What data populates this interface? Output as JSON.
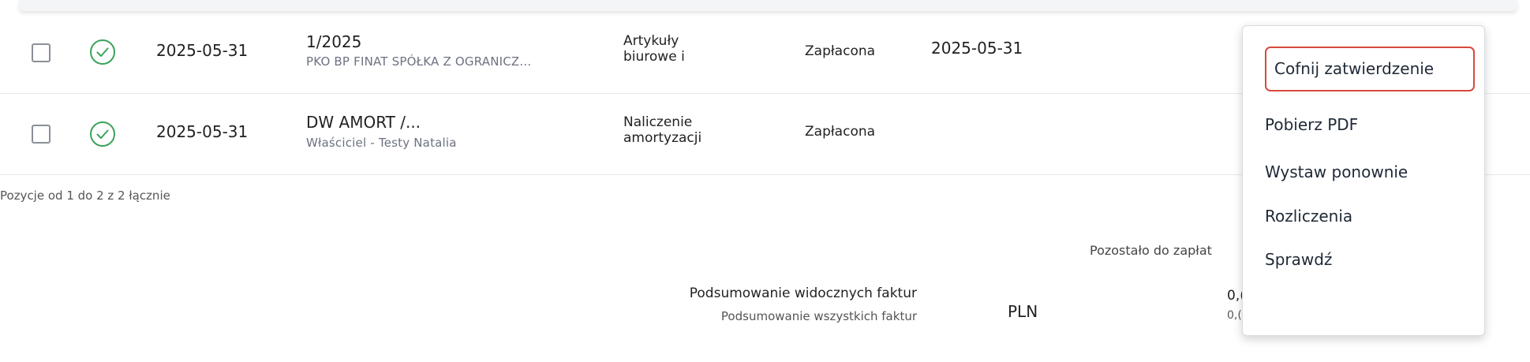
{
  "rows": [
    {
      "date": "2025-05-31",
      "number": "1/2025",
      "contractor": "PKO BP FINAT SPÓŁKA Z OGRANICZ...",
      "category_line1": "Artykuły",
      "category_line2": "biurowe i",
      "status": "Zapłacona",
      "payment_date": "2025-05-31"
    },
    {
      "date": "2025-05-31",
      "number": "DW AMORT /...",
      "contractor": "Właściciel - Testy Natalia",
      "category_line1": "Naliczenie",
      "category_line2": "amortyzacji",
      "status": "Zapłacona",
      "payment_date": ""
    }
  ],
  "footer_note": "Pozycje od 1 do 2 z 2 łącznie",
  "summary": {
    "visible_label": "Podsumowanie widocznych faktur",
    "all_label": "Podsumowanie wszystkich faktur",
    "currency": "PLN",
    "remaining_label": "Pozostało do zapłat",
    "visible_value": "0,(",
    "all_value": "0,("
  },
  "context_menu": {
    "items": [
      "Cofnij zatwierdzenie",
      "Pobierz PDF",
      "Wystaw ponownie",
      "Rozliczenia",
      "Sprawdź"
    ],
    "highlighted_index": 0
  },
  "colors": {
    "status_ok_green": "#3aa35a",
    "highlight_border": "#d54b3d"
  },
  "icons": {
    "status": "check-circle-icon"
  }
}
